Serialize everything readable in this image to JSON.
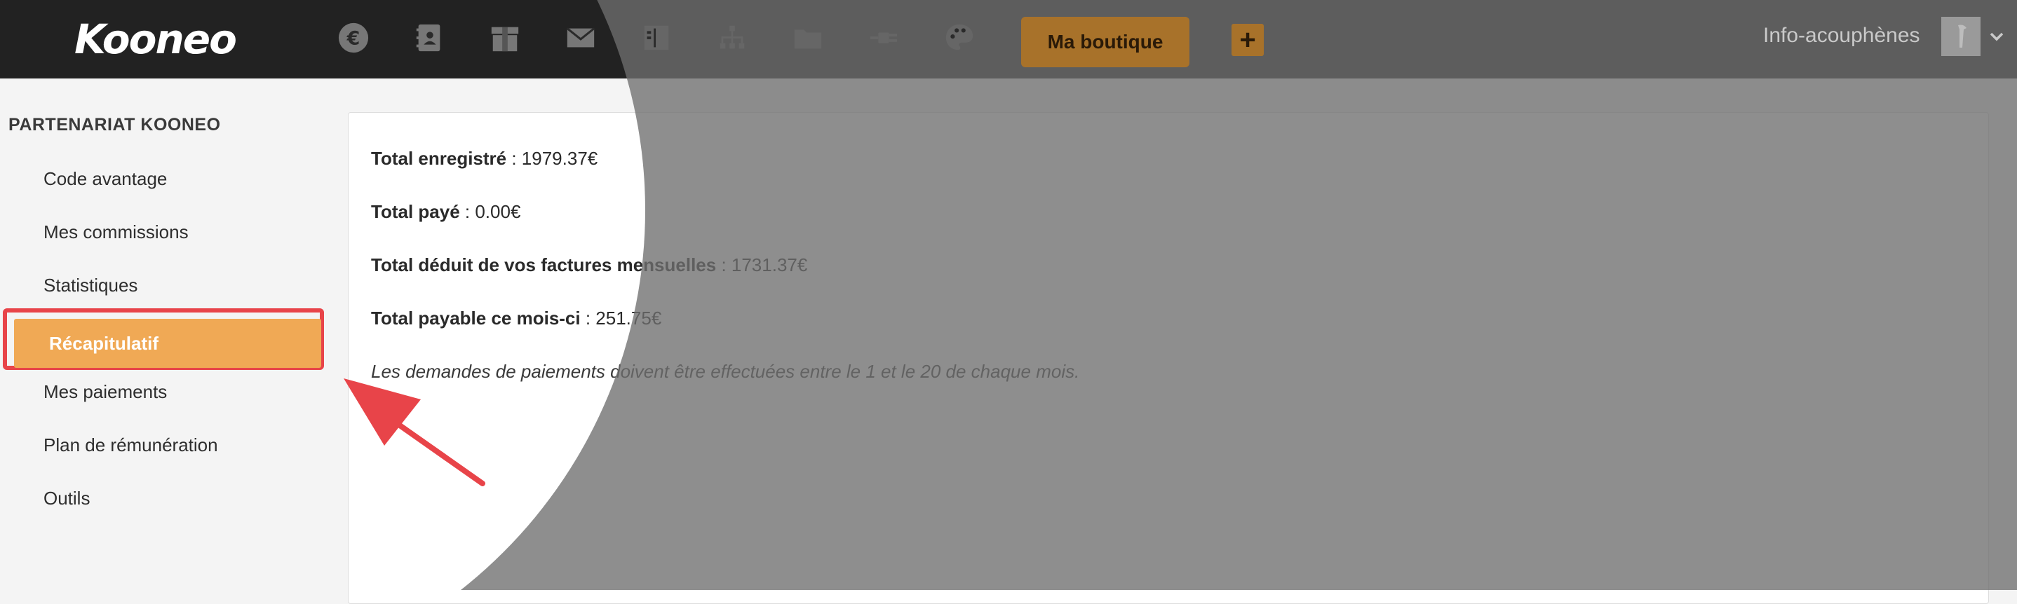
{
  "header": {
    "logo": "Kooneo",
    "nav_icons": [
      "euro-icon",
      "contacts-icon",
      "box-icon",
      "mail-icon",
      "layout-icon",
      "sitemap-icon",
      "folder-icon",
      "plug-icon",
      "palette-icon"
    ],
    "shop_button": "Ma boutique",
    "plus_button": "+",
    "user_name": "Info-acouphènes",
    "accent_color": "#a8722a"
  },
  "sidebar": {
    "title": "PARTENARIAT KOONEO",
    "items": [
      {
        "label": "Code avantage"
      },
      {
        "label": "Mes commissions"
      },
      {
        "label": "Statistiques"
      },
      {
        "label": "Récapitulatif",
        "active": true
      },
      {
        "label": "Mes paiements"
      },
      {
        "label": "Plan de rémunération"
      },
      {
        "label": "Outils"
      }
    ],
    "active_color": "#f0a955",
    "highlight_color": "#e84449"
  },
  "summary": {
    "total_registered_label": "Total enregistré",
    "total_registered_value": " : 1979.37€",
    "total_paid_label": "Total payé",
    "total_paid_value": " : 0.00€",
    "total_deducted_label": "Total déduit de vos factures mensuelles",
    "total_deducted_value": " : 1731.37€",
    "total_payable_label": "Total payable ce mois-ci",
    "total_payable_value": " : 251.75€",
    "note": "Les demandes de paiements doivent être effectuées entre le 1 et le 20 de chaque mois."
  }
}
